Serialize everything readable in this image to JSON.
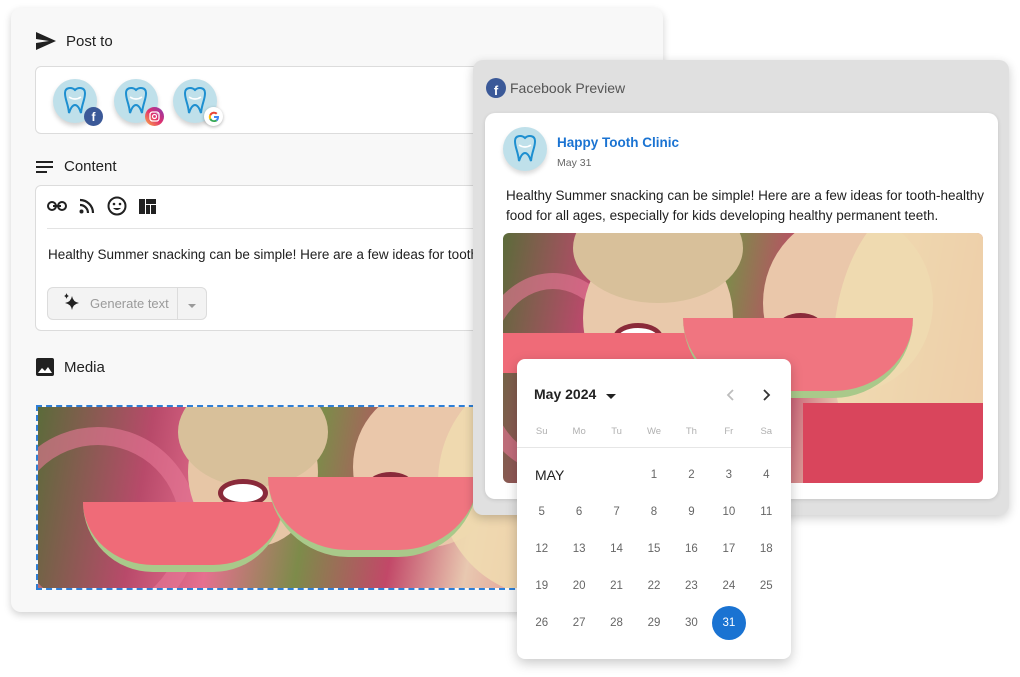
{
  "composer": {
    "post_to": {
      "label": "Post to",
      "icon": "send-icon",
      "accounts": [
        {
          "name": "Happy Tooth Clinic",
          "network": "facebook",
          "badge_glyph": "f",
          "badge_color": "#3b5998"
        },
        {
          "name": "Happy Tooth Clinic",
          "network": "instagram",
          "badge_glyph": "◎",
          "badge_color": "#e1306c"
        },
        {
          "name": "Happy Tooth Clinic",
          "network": "google",
          "badge_glyph": "G",
          "badge_color": "#4285f4"
        }
      ]
    },
    "content": {
      "label": "Content",
      "icon": "notes-icon",
      "toolbar": [
        "link-icon",
        "rss-icon",
        "emoji-icon",
        "template-icon"
      ],
      "text": "Healthy Summer snacking can be simple! Here are a few ideas for tooth",
      "generate_button": "Generate text",
      "generate_icon": "sparkle-icon"
    },
    "media": {
      "label": "Media",
      "icon": "image-icon",
      "image_alt": "Girl and woman laughing while eating watermelon slices"
    }
  },
  "preview": {
    "title": "Facebook Preview",
    "page_name": "Happy Tooth Clinic",
    "date": "May 31",
    "text": "Healthy Summer snacking can be simple! Here are a few ideas for tooth-healthy food for all ages, especially for kids developing healthy permanent teeth.",
    "image_alt": "Girl and woman laughing while eating watermelon slices"
  },
  "calendar": {
    "title": "May 2024",
    "month_label": "MAY",
    "weekdays": [
      "Su",
      "Mo",
      "Tu",
      "We",
      "Th",
      "Fr",
      "Sa"
    ],
    "first_weekday_index": 3,
    "days_in_month": 31,
    "selected_day": 31,
    "accent_color": "#1a73d2"
  },
  "colors": {
    "accent": "#1a73d2",
    "facebook": "#3b5998",
    "dashed_border": "#2f7fd6"
  }
}
